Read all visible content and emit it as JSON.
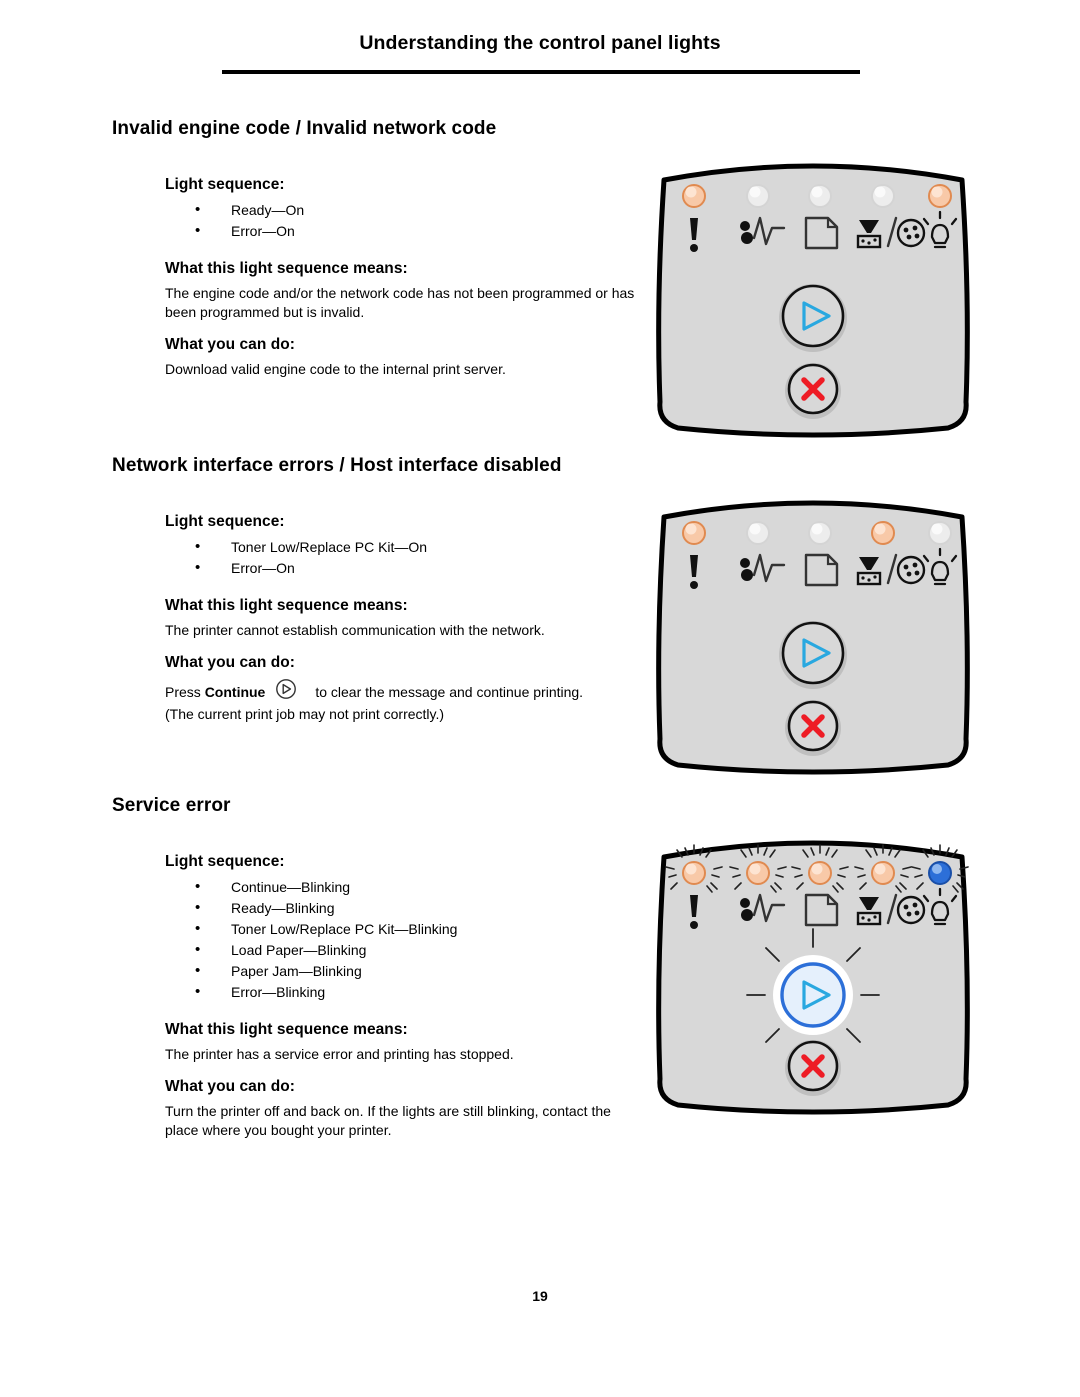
{
  "header": {
    "title": "Understanding the control panel lights"
  },
  "footer": {
    "page_number": "19"
  },
  "labels": {
    "light_sequence": "Light sequence:",
    "means": "What this light sequence means:",
    "can_do": "What you can do:"
  },
  "colors": {
    "led_on_orange": "#F5A878",
    "led_on_blue": "#2C6FD8",
    "led_off": "#E8E8E8",
    "panel_face": "#D8D8D8",
    "panel_outline": "#000000",
    "continue_arrow": "#29A8E0",
    "cancel_x": "#EE1C25"
  },
  "led_icons": {
    "error": "exclamation-icon",
    "paper_jam": "paper-jam-icon",
    "load_paper": "paper-sheet-icon",
    "toner_low": "toner-pc-kit-icon",
    "ready": "light-bulb-icon"
  },
  "sections": [
    {
      "heading": "Invalid engine code / Invalid network code",
      "light_sequence": [
        "Ready—On",
        "Error—On"
      ],
      "means": "The engine code and/or the network code has not been programmed or has been programmed but is invalid.",
      "can_do": "Download valid engine code to the internal print server.",
      "can_do_has_icon": false,
      "panel": {
        "leds": [
          {
            "name": "error-led",
            "state": "on",
            "color": "orange"
          },
          {
            "name": "paper-jam-led",
            "state": "off",
            "color": "none"
          },
          {
            "name": "load-paper-led",
            "state": "off",
            "color": "none"
          },
          {
            "name": "toner-low-led",
            "state": "off",
            "color": "none"
          },
          {
            "name": "ready-led",
            "state": "on",
            "color": "orange"
          }
        ],
        "continue_button": {
          "state": "off"
        },
        "cancel_button": {
          "state": "off"
        }
      }
    },
    {
      "heading": "Network interface errors / Host interface disabled",
      "light_sequence": [
        "Toner Low/Replace PC Kit—On",
        "Error—On"
      ],
      "means": "The printer cannot establish communication with the network.",
      "can_do_prefix": "Press ",
      "can_do_bold": "Continue",
      "can_do_suffix": "to clear the message and continue printing.",
      "can_do_line2": "(The current print job may not print correctly.)",
      "can_do_has_icon": true,
      "panel": {
        "leds": [
          {
            "name": "error-led",
            "state": "on",
            "color": "orange"
          },
          {
            "name": "paper-jam-led",
            "state": "off",
            "color": "none"
          },
          {
            "name": "load-paper-led",
            "state": "off",
            "color": "none"
          },
          {
            "name": "toner-low-led",
            "state": "on",
            "color": "orange"
          },
          {
            "name": "ready-led",
            "state": "off",
            "color": "none"
          }
        ],
        "continue_button": {
          "state": "off"
        },
        "cancel_button": {
          "state": "off"
        }
      }
    },
    {
      "heading": "Service error",
      "light_sequence": [
        "Continue—Blinking",
        "Ready—Blinking",
        "Toner Low/Replace PC Kit—Blinking",
        "Load Paper—Blinking",
        "Paper Jam—Blinking",
        "Error—Blinking"
      ],
      "means": "The printer has a service error and printing has stopped.",
      "can_do": "Turn the printer off and back on. If the lights are still blinking, contact the place where you bought your printer.",
      "can_do_has_icon": false,
      "panel": {
        "leds": [
          {
            "name": "error-led",
            "state": "blinking",
            "color": "orange"
          },
          {
            "name": "paper-jam-led",
            "state": "blinking",
            "color": "orange"
          },
          {
            "name": "load-paper-led",
            "state": "blinking",
            "color": "orange"
          },
          {
            "name": "toner-low-led",
            "state": "blinking",
            "color": "orange"
          },
          {
            "name": "ready-led",
            "state": "blinking",
            "color": "blue"
          }
        ],
        "continue_button": {
          "state": "blinking"
        },
        "cancel_button": {
          "state": "off"
        }
      }
    }
  ]
}
